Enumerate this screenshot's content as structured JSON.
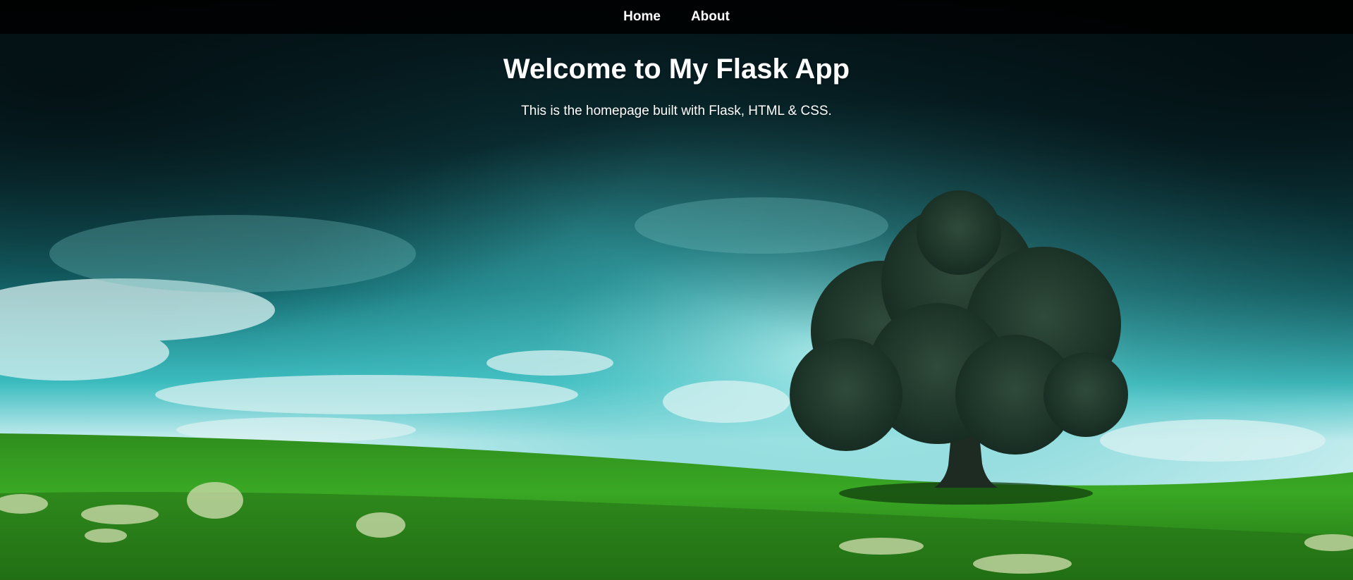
{
  "nav": {
    "items": [
      {
        "label": "Home"
      },
      {
        "label": "About"
      }
    ]
  },
  "hero": {
    "title": "Welcome to My Flask App",
    "subtitle": "This is the homepage built with Flask, HTML & CSS."
  },
  "colors": {
    "nav_background": "#000000",
    "text": "#ffffff",
    "sky_dark": "#061c22",
    "sky_light": "#2fb3b8",
    "grass": "#2e9a1c",
    "tree": "#1f3a2c"
  },
  "background": {
    "icon": "landscape-tree-field-image"
  }
}
